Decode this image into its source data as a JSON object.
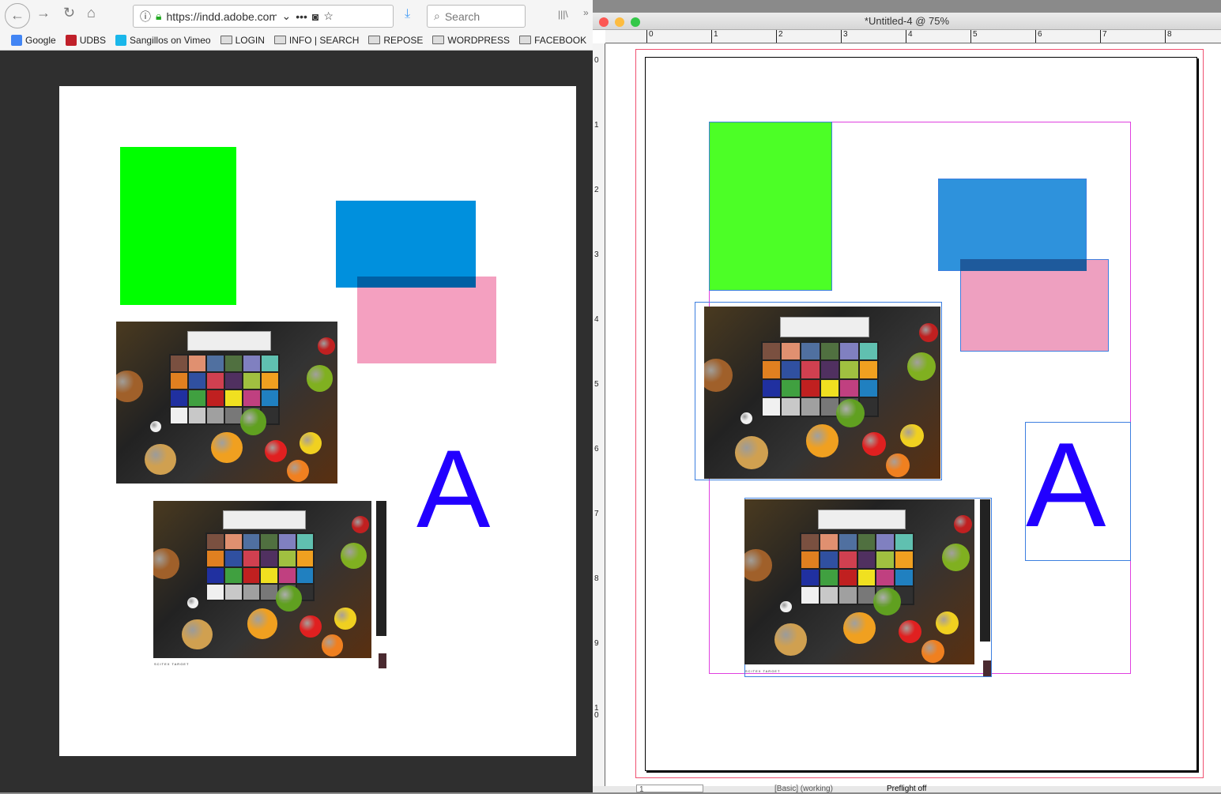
{
  "browser": {
    "url": "https://indd.adobe.com",
    "search_placeholder": "Search",
    "bookmarks": [
      {
        "label": "Google",
        "icon": "google-icon"
      },
      {
        "label": "UDBS",
        "icon": "udbs-icon"
      },
      {
        "label": "Sangillos on Vimeo",
        "icon": "vimeo-icon"
      },
      {
        "label": "LOGIN",
        "icon": "folder-icon"
      },
      {
        "label": "INFO | SEARCH",
        "icon": "folder-icon"
      },
      {
        "label": "REPOSE",
        "icon": "folder-icon"
      },
      {
        "label": "WORDPRESS",
        "icon": "folder-icon"
      },
      {
        "label": "FACEBOOK",
        "icon": "folder-icon"
      }
    ]
  },
  "document": {
    "letter": "A",
    "caption": "SCITEX TARGET",
    "colors": {
      "green_web": "#00ff00",
      "blue_web": "#0090dd",
      "pink_web": "#f4a0c0",
      "green_indd": "#4cff26",
      "blue_indd": "#2e92dc",
      "pink_indd": "#eea0c0",
      "letter": "#2200ff"
    }
  },
  "indesign": {
    "title": "*Untitled-4 @ 75%",
    "ruler_h": [
      "0",
      "1",
      "2",
      "3",
      "4",
      "5",
      "6",
      "7",
      "8"
    ],
    "ruler_v": [
      "0",
      "1",
      "2",
      "3",
      "4",
      "5",
      "6",
      "7",
      "8",
      "9",
      "10"
    ],
    "page_number": "1",
    "workspace": "[Basic] (working)",
    "preflight": "Preflight off"
  }
}
